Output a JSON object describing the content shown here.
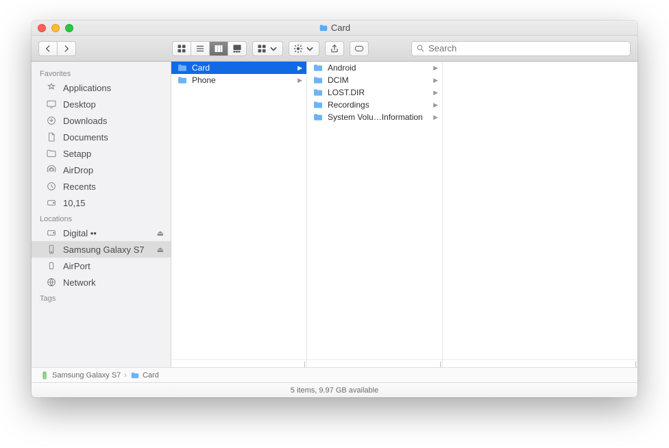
{
  "window": {
    "title": "Card"
  },
  "search": {
    "placeholder": "Search"
  },
  "sidebar": {
    "groups": [
      {
        "label": "Favorites",
        "items": [
          {
            "label": "Applications",
            "icon": "apps"
          },
          {
            "label": "Desktop",
            "icon": "desktop"
          },
          {
            "label": "Downloads",
            "icon": "downloads"
          },
          {
            "label": "Documents",
            "icon": "documents"
          },
          {
            "label": "Setapp",
            "icon": "folder"
          },
          {
            "label": "AirDrop",
            "icon": "airdrop"
          },
          {
            "label": "Recents",
            "icon": "recents"
          },
          {
            "label": "10,15",
            "icon": "disk"
          }
        ]
      },
      {
        "label": "Locations",
        "items": [
          {
            "label": "Digital ••",
            "icon": "disk",
            "ejectable": true
          },
          {
            "label": "Samsung Galaxy S7",
            "icon": "device",
            "ejectable": true,
            "selected": true
          },
          {
            "label": "AirPort",
            "icon": "airport"
          },
          {
            "label": "Network",
            "icon": "network"
          }
        ]
      },
      {
        "label": "Tags",
        "items": []
      }
    ]
  },
  "columns": [
    {
      "items": [
        {
          "label": "Card",
          "hasChildren": true,
          "selected": true
        },
        {
          "label": "Phone",
          "hasChildren": true
        }
      ]
    },
    {
      "items": [
        {
          "label": "Android",
          "hasChildren": true
        },
        {
          "label": "DCIM",
          "hasChildren": true
        },
        {
          "label": "LOST.DIR",
          "hasChildren": true
        },
        {
          "label": "Recordings",
          "hasChildren": true
        },
        {
          "label": "System Volu…Information",
          "hasChildren": true
        }
      ]
    },
    {
      "items": []
    }
  ],
  "path": {
    "segments": [
      {
        "label": "Samsung Galaxy S7",
        "icon": "device"
      },
      {
        "label": "Card",
        "icon": "folder"
      }
    ]
  },
  "status": {
    "text": "5 items, 9.97 GB available"
  }
}
